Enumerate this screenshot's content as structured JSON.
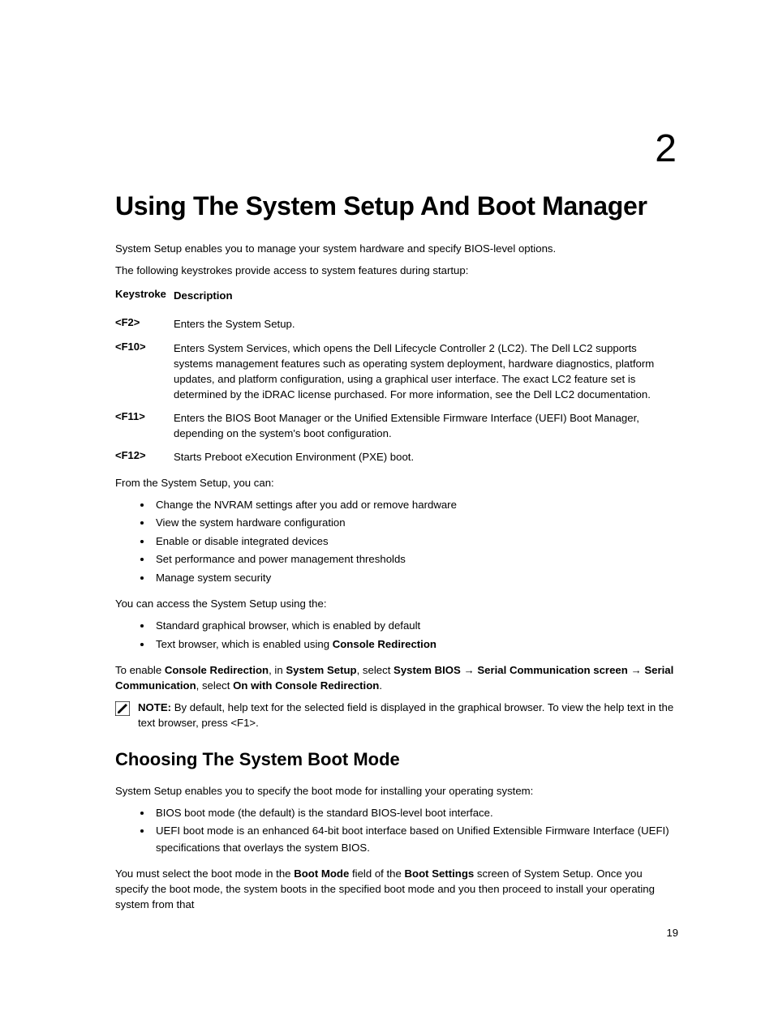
{
  "chapter_number": "2",
  "h1": "Using The System Setup And Boot Manager",
  "intro_p1": "System Setup enables you to manage your system hardware and specify BIOS-level options.",
  "intro_p2": "The following keystrokes provide access to system features during startup:",
  "kt_header_key": "Keystroke",
  "kt_header_desc": "Description",
  "kt": [
    {
      "key": "<F2>",
      "desc": "Enters the System Setup."
    },
    {
      "key": "<F10>",
      "desc": "Enters System Services, which opens the Dell Lifecycle Controller 2 (LC2). The Dell LC2 supports systems management features such as operating system deployment, hardware diagnostics, platform updates, and platform configuration, using a graphical user interface. The exact LC2 feature set is determined by the iDRAC license purchased. For more information, see the Dell LC2 documentation."
    },
    {
      "key": "<F11>",
      "desc": "Enters the BIOS Boot Manager or the Unified Extensible Firmware Interface (UEFI) Boot Manager, depending on the system's boot configuration."
    },
    {
      "key": "<F12>",
      "desc": "Starts Preboot eXecution Environment (PXE) boot."
    }
  ],
  "from_setup": "From the System Setup, you can:",
  "can_list": [
    "Change the NVRAM settings after you add or remove hardware",
    "View the system hardware configuration",
    "Enable or disable integrated devices",
    "Set performance and power management thresholds",
    "Manage system security"
  ],
  "access_intro": "You can access the System Setup using the:",
  "access_list_0": "Standard graphical browser, which is enabled by default",
  "access_list_1a": "Text browser, which is enabled using ",
  "access_list_1b": "Console Redirection",
  "enable": {
    "pre": "To enable ",
    "console_redir": "Console Redirection",
    "in": ", in ",
    "system_setup": "System Setup",
    "select1": ", select ",
    "system_bios": "System BIOS",
    "arrow1": " → ",
    "serial_comm_screen": "Serial Communication screen",
    "arrow2": " → ",
    "serial_comm": "Serial Communication",
    "select2": ", select ",
    "on_with": "On with Console Redirection",
    "period": "."
  },
  "note_label": "NOTE:",
  "note_text": " By default, help text for the selected field is displayed in the graphical browser. To view the help text in the text browser, press <F1>.",
  "h2": "Choosing The System Boot Mode",
  "boot_intro": "System Setup enables you to specify the boot mode for installing your operating system:",
  "boot_list": [
    "BIOS boot mode (the default) is the standard BIOS-level boot interface.",
    "UEFI boot mode is an enhanced 64-bit boot interface based on Unified Extensible Firmware Interface (UEFI) specifications that overlays the system BIOS."
  ],
  "must": {
    "pre": "You must select the boot mode in the ",
    "boot_mode": "Boot Mode",
    "mid1": " field of the ",
    "boot_settings": "Boot Settings",
    "post": " screen of System Setup. Once you specify the boot mode, the system boots in the specified boot mode and you then proceed to install your operating system from that"
  },
  "page_number": "19"
}
